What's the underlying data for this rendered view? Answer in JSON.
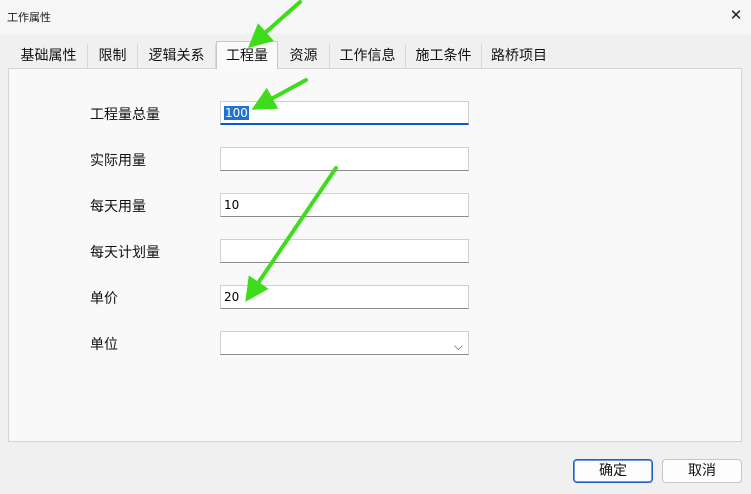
{
  "window": {
    "title": "工作属性"
  },
  "tabs": [
    {
      "label": "基础属性"
    },
    {
      "label": "限制"
    },
    {
      "label": "逻辑关系"
    },
    {
      "label": "工程量",
      "active": true
    },
    {
      "label": "资源"
    },
    {
      "label": "工作信息"
    },
    {
      "label": "施工条件"
    },
    {
      "label": "路桥项目"
    }
  ],
  "form": {
    "total_quantity": {
      "label": "工程量总量",
      "value": "100"
    },
    "actual_quantity": {
      "label": "实际用量",
      "value": ""
    },
    "daily_quantity": {
      "label": "每天用量",
      "value": "10"
    },
    "daily_planned": {
      "label": "每天计划量",
      "value": ""
    },
    "unit_price": {
      "label": "单价",
      "value": "20"
    },
    "unit": {
      "label": "单位",
      "value": ""
    }
  },
  "buttons": {
    "ok": "确定",
    "cancel": "取消"
  },
  "annotation": {
    "arrow_color": "#3fdc1c",
    "icon": "green-arrow-icon"
  },
  "colors": {
    "selection": "#1f72d6",
    "focus_underline": "#0a5bd3"
  }
}
